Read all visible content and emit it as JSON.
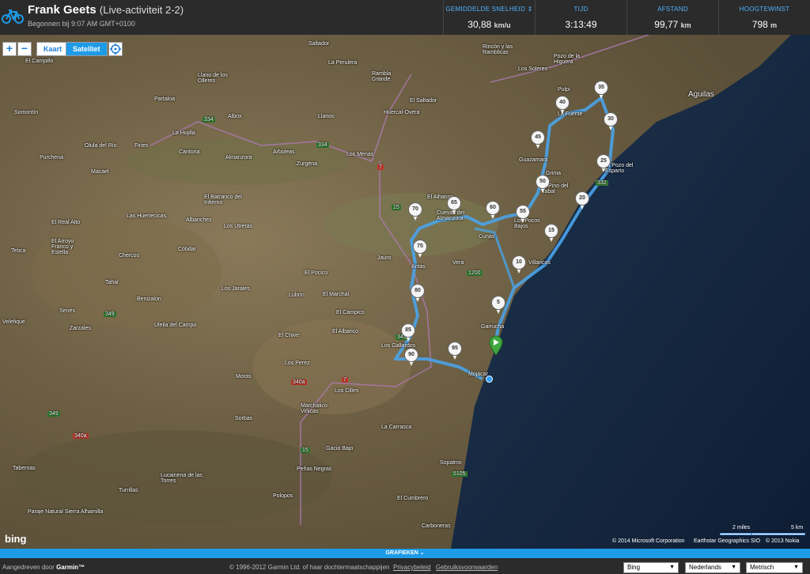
{
  "header": {
    "athlete_name": "Frank Geets",
    "activity_title": "(Live-activiteit 2-2)",
    "started": "Begonnen bij 9:07 AM GMT+0100",
    "stats": [
      {
        "label": "GEMIDDELDE SNELHEID ⇕",
        "value": "30,88",
        "unit": "km/u"
      },
      {
        "label": "TIJD",
        "value": "3:13:49",
        "unit": ""
      },
      {
        "label": "AFSTAND",
        "value": "99,77",
        "unit": "km"
      },
      {
        "label": "HOOGTEWINST",
        "value": "798",
        "unit": "m"
      }
    ]
  },
  "map_controls": {
    "zoom_in": "+",
    "zoom_out": "−",
    "map_type_map": "Kaart",
    "map_type_satellite": "Satelliet"
  },
  "map_places": [
    {
      "name": "El Campillo"
    },
    {
      "name": "Llano de los Olleres"
    },
    {
      "name": "Saltador"
    },
    {
      "name": "La Perulera"
    },
    {
      "name": "Rambla Grande"
    },
    {
      "name": "El Saltador"
    },
    {
      "name": "Huercal-Overa"
    },
    {
      "name": "Rincón y las Ramblicas"
    },
    {
      "name": "Pozo de la Higuera"
    },
    {
      "name": "Los Soleres"
    },
    {
      "name": "Pulpí"
    },
    {
      "name": "Aguilas"
    },
    {
      "name": "Partaloa"
    },
    {
      "name": "Somontín"
    },
    {
      "name": "Albox"
    },
    {
      "name": "Llanos"
    },
    {
      "name": "La Fuente"
    },
    {
      "name": "La Hojilla"
    },
    {
      "name": "Olula del Río"
    },
    {
      "name": "Fines"
    },
    {
      "name": "Cantoria"
    },
    {
      "name": "Arboleas"
    },
    {
      "name": "Almanzora"
    },
    {
      "name": "Zurgena"
    },
    {
      "name": "Los Menas"
    },
    {
      "name": "Purchena"
    },
    {
      "name": "Macael"
    },
    {
      "name": "Guazamara"
    },
    {
      "name": "Grima"
    },
    {
      "name": "El Pino del Tabal"
    },
    {
      "name": "El Pozo del Esparto"
    },
    {
      "name": "El Barranco del Infierno"
    },
    {
      "name": "El Aihanse"
    },
    {
      "name": "Cuevas del Almanzora"
    },
    {
      "name": "Cunas"
    },
    {
      "name": "Los Pocos Bajos"
    },
    {
      "name": "El Real Alto"
    },
    {
      "name": "Las Huertecicas"
    },
    {
      "name": "Albanchez"
    },
    {
      "name": "Los Utreras"
    },
    {
      "name": "Villaricos"
    },
    {
      "name": "El Arroyo Franco y Estella"
    },
    {
      "name": "Cóbdar"
    },
    {
      "name": "Chercos"
    },
    {
      "name": "Tetica"
    },
    {
      "name": "Jauro"
    },
    {
      "name": "Vera"
    },
    {
      "name": "Antas"
    },
    {
      "name": "Tahal"
    },
    {
      "name": "El Pocico"
    },
    {
      "name": "Los Jarales"
    },
    {
      "name": "Lubrín"
    },
    {
      "name": "El Marchal"
    },
    {
      "name": "Benizalon"
    },
    {
      "name": "Senés"
    },
    {
      "name": "Velefique"
    },
    {
      "name": "Zarzales"
    },
    {
      "name": "Uleila del Campo"
    },
    {
      "name": "El Campico"
    },
    {
      "name": "El Albarico"
    },
    {
      "name": "El Chive"
    },
    {
      "name": "Garrucha"
    },
    {
      "name": "Los Gallardos"
    },
    {
      "name": "Los Perez"
    },
    {
      "name": "Mojácar"
    },
    {
      "name": "Moras"
    },
    {
      "name": "Los Cilles"
    },
    {
      "name": "Marchalico Viñicas"
    },
    {
      "name": "Sorbas"
    },
    {
      "name": "La Carrasca"
    },
    {
      "name": "Gacia Bajo"
    },
    {
      "name": "Tabernas"
    },
    {
      "name": "Peñas Negras"
    },
    {
      "name": "Sopalmo"
    },
    {
      "name": "Lucainena de las Torres"
    },
    {
      "name": "Turrillas"
    },
    {
      "name": "Polopos"
    },
    {
      "name": "El Cumbrero"
    },
    {
      "name": "Paraje Natural Sierra Alhamilla"
    },
    {
      "name": "Carboneras"
    }
  ],
  "road_labels": [
    {
      "name": "334"
    },
    {
      "name": "334"
    },
    {
      "name": "7"
    },
    {
      "name": "15"
    },
    {
      "name": "332"
    },
    {
      "name": "1200"
    },
    {
      "name": "349"
    },
    {
      "name": "349"
    },
    {
      "name": "340a"
    },
    {
      "name": "7"
    },
    {
      "name": "349"
    },
    {
      "name": "340a"
    },
    {
      "name": "15"
    },
    {
      "name": "5105"
    }
  ],
  "km_markers": [
    "5",
    "10",
    "15",
    "20",
    "25",
    "30",
    "35",
    "40",
    "45",
    "50",
    "55",
    "60",
    "65",
    "70",
    "75",
    "80",
    "85",
    "90",
    "95"
  ],
  "map_footer": {
    "bing_logo": "bing",
    "copyright_ms": "© 2014 Microsoft Corporation",
    "copyright_earthstar": "Earthstar Geographics SIO",
    "copyright_nokia": "© 2013 Nokia",
    "scale_miles": "2 miles",
    "scale_km": "5 km"
  },
  "graphs_label": "GRAFIEKEN ⌄",
  "footer": {
    "powered_by": "Aangedreven door",
    "brand": "Garmin™",
    "copyright": "© 1996-2012 Garmin Ltd. of haar dochtermaatschappijen",
    "privacy": "Privacybeleid",
    "terms": "Gebruiksvoorwaarden",
    "map_provider": "Bing",
    "language": "Nederlands",
    "units": "Metrisch"
  },
  "colors": {
    "accent": "#1e9be8",
    "route": "#4aa3e8",
    "header_bg": "#2b2b2b"
  }
}
